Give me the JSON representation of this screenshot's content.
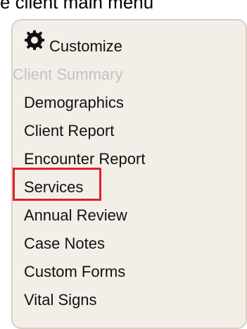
{
  "caption": "e client main menu",
  "menu": {
    "customize_label": "Customize",
    "items": [
      {
        "label": "Client Summary",
        "enabled": false
      },
      {
        "label": "Demographics",
        "enabled": true
      },
      {
        "label": "Client Report",
        "enabled": true
      },
      {
        "label": "Encounter Report",
        "enabled": true
      },
      {
        "label": "Services",
        "enabled": true,
        "highlighted": true
      },
      {
        "label": "Annual Review",
        "enabled": true
      },
      {
        "label": "Case Notes",
        "enabled": true
      },
      {
        "label": "Custom Forms",
        "enabled": true
      },
      {
        "label": "Vital Signs",
        "enabled": true
      }
    ]
  },
  "colors": {
    "panel_bg": "#f3efe8",
    "panel_border": "#d8d0c6",
    "highlight": "#e0202a",
    "disabled_text": "#c3c3c3"
  },
  "icons": {
    "customize": "gear-icon"
  }
}
